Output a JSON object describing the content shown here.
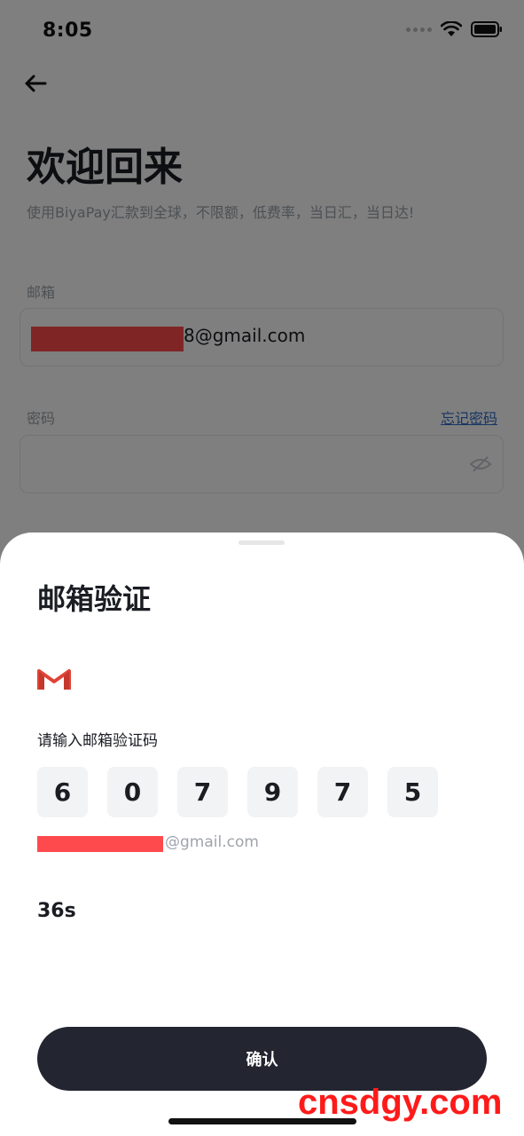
{
  "status": {
    "time": "8:05"
  },
  "login": {
    "title": "欢迎回来",
    "subtitle": "使用BiyaPay汇款到全球，不限额，低费率，当日汇，当日达!",
    "email_label": "邮箱",
    "email_value_visible": "8@gmail.com",
    "password_label": "密码",
    "forgot_label": "忘记密码"
  },
  "sheet": {
    "title": "邮箱验证",
    "icon": "gmail-icon",
    "prompt": "请输入邮箱验证码",
    "code": [
      "6",
      "0",
      "7",
      "9",
      "7",
      "5"
    ],
    "email_suffix": "@gmail.com",
    "countdown": "36s",
    "confirm_label": "确认"
  },
  "watermark": "cnsdgy.com",
  "colors": {
    "primary_button": "#232630",
    "link": "#2f6cc4",
    "redaction": "#ff4a4d",
    "watermark": "#ff1a1a"
  }
}
